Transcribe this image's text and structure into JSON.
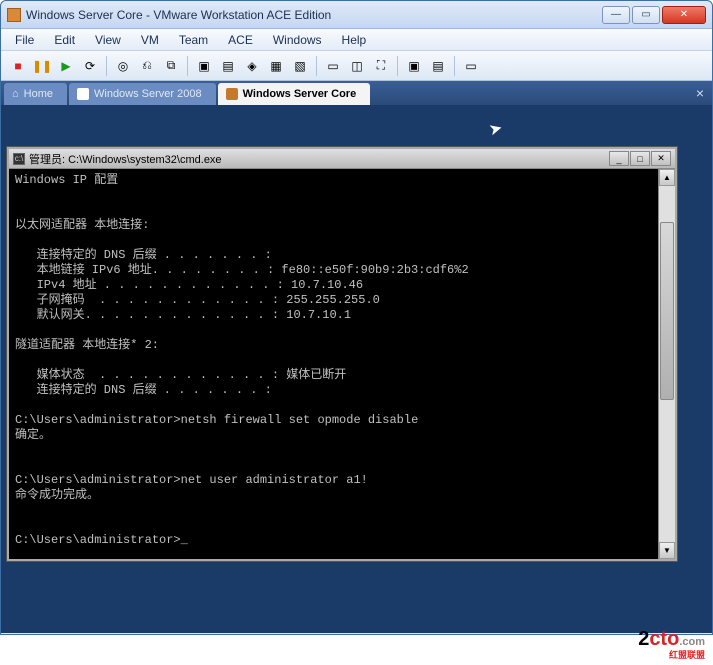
{
  "window": {
    "title": "Windows Server Core - VMware Workstation ACE Edition"
  },
  "menu": [
    "File",
    "Edit",
    "View",
    "VM",
    "Team",
    "ACE",
    "Windows",
    "Help"
  ],
  "tabs": [
    {
      "label": "Home",
      "active": false,
      "home": true
    },
    {
      "label": "Windows Server 2008",
      "active": false
    },
    {
      "label": "Windows Server Core",
      "active": true
    }
  ],
  "cmd": {
    "title": "管理员: C:\\Windows\\system32\\cmd.exe",
    "lines": [
      "Windows IP 配置",
      "",
      "",
      "以太网适配器 本地连接:",
      "",
      "   连接特定的 DNS 后缀 . . . . . . . :",
      "   本地链接 IPv6 地址. . . . . . . . : fe80::e50f:90b9:2b3:cdf6%2",
      "   IPv4 地址 . . . . . . . . . . . . : 10.7.10.46",
      "   子网掩码  . . . . . . . . . . . . : 255.255.255.0",
      "   默认网关. . . . . . . . . . . . . : 10.7.10.1",
      "",
      "隧道适配器 本地连接* 2:",
      "",
      "   媒体状态  . . . . . . . . . . . . : 媒体已断开",
      "   连接特定的 DNS 后缀 . . . . . . . :",
      "",
      "C:\\Users\\administrator>netsh firewall set opmode disable",
      "确定。",
      "",
      "",
      "C:\\Users\\administrator>net user administrator a1!",
      "命令成功完成。",
      "",
      "",
      "C:\\Users\\administrator>_"
    ]
  },
  "watermark": {
    "a": "2",
    "b": "cto",
    "c": ".com",
    "d": "红盟联盟"
  }
}
